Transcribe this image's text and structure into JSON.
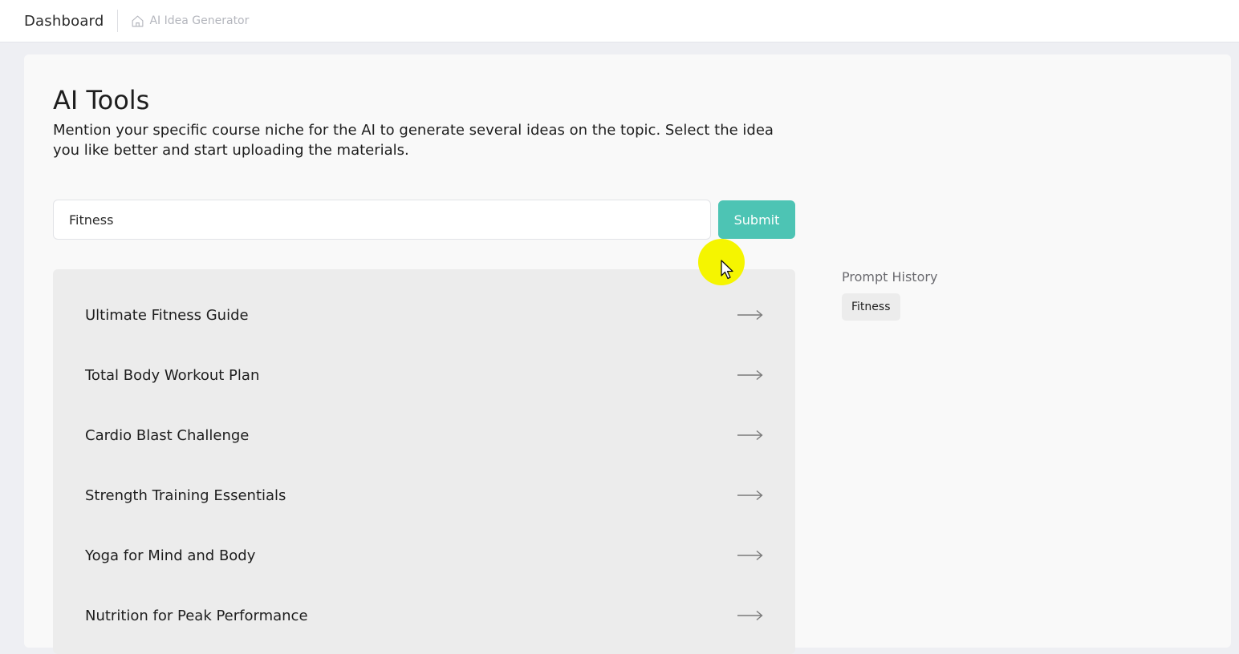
{
  "header": {
    "title": "Dashboard",
    "breadcrumb": "AI Idea Generator"
  },
  "main": {
    "title": "AI Tools",
    "description": "Mention your specific course niche for the AI to generate several ideas on the topic. Select the idea you like better and start uploading the materials.",
    "input_value": "Fitness",
    "submit_label": "Submit",
    "ideas": [
      "Ultimate Fitness Guide",
      "Total Body Workout Plan",
      "Cardio Blast Challenge",
      "Strength Training Essentials",
      "Yoga for Mind and Body",
      "Nutrition for Peak Performance"
    ]
  },
  "history": {
    "title": "Prompt History",
    "items": [
      "Fitness"
    ]
  },
  "colors": {
    "accent": "#4dc4b4",
    "cursor_highlight": "#f5f500"
  },
  "icons": {
    "breadcrumb": "home-icon",
    "idea_action": "arrow-right-icon",
    "cursor": "mouse-pointer-icon"
  }
}
